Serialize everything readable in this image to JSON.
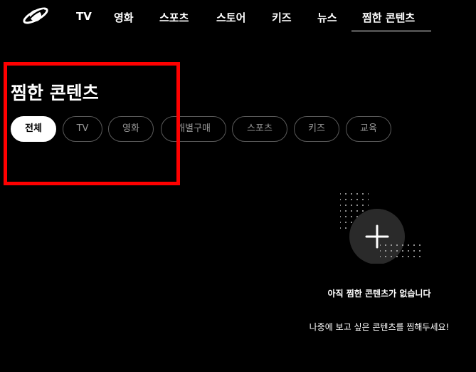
{
  "nav": {
    "items": [
      {
        "label": "TV"
      },
      {
        "label": "영화"
      },
      {
        "label": "스포츠"
      },
      {
        "label": "스토어"
      },
      {
        "label": "키즈"
      },
      {
        "label": "뉴스"
      },
      {
        "label": "찜한 콘텐츠",
        "active": true
      }
    ]
  },
  "page": {
    "title": "찜한 콘텐츠"
  },
  "filters": {
    "chips": [
      {
        "label": "전체",
        "selected": true
      },
      {
        "label": "TV"
      },
      {
        "label": "영화"
      },
      {
        "label": "개별구매"
      },
      {
        "label": "스포츠"
      },
      {
        "label": "키즈"
      },
      {
        "label": "교육"
      }
    ]
  },
  "empty_state": {
    "icon": "plus-icon",
    "title": "아직 찜한 콘텐츠가 없습니다",
    "subtitle": "나중에 보고 싶은 콘텐츠를 찜해두세요!"
  },
  "colors": {
    "background": "#000000",
    "text": "#ffffff",
    "chip_border": "#5a5a5a",
    "chip_text": "#9a9a9a",
    "annotation": "#ff0000"
  }
}
